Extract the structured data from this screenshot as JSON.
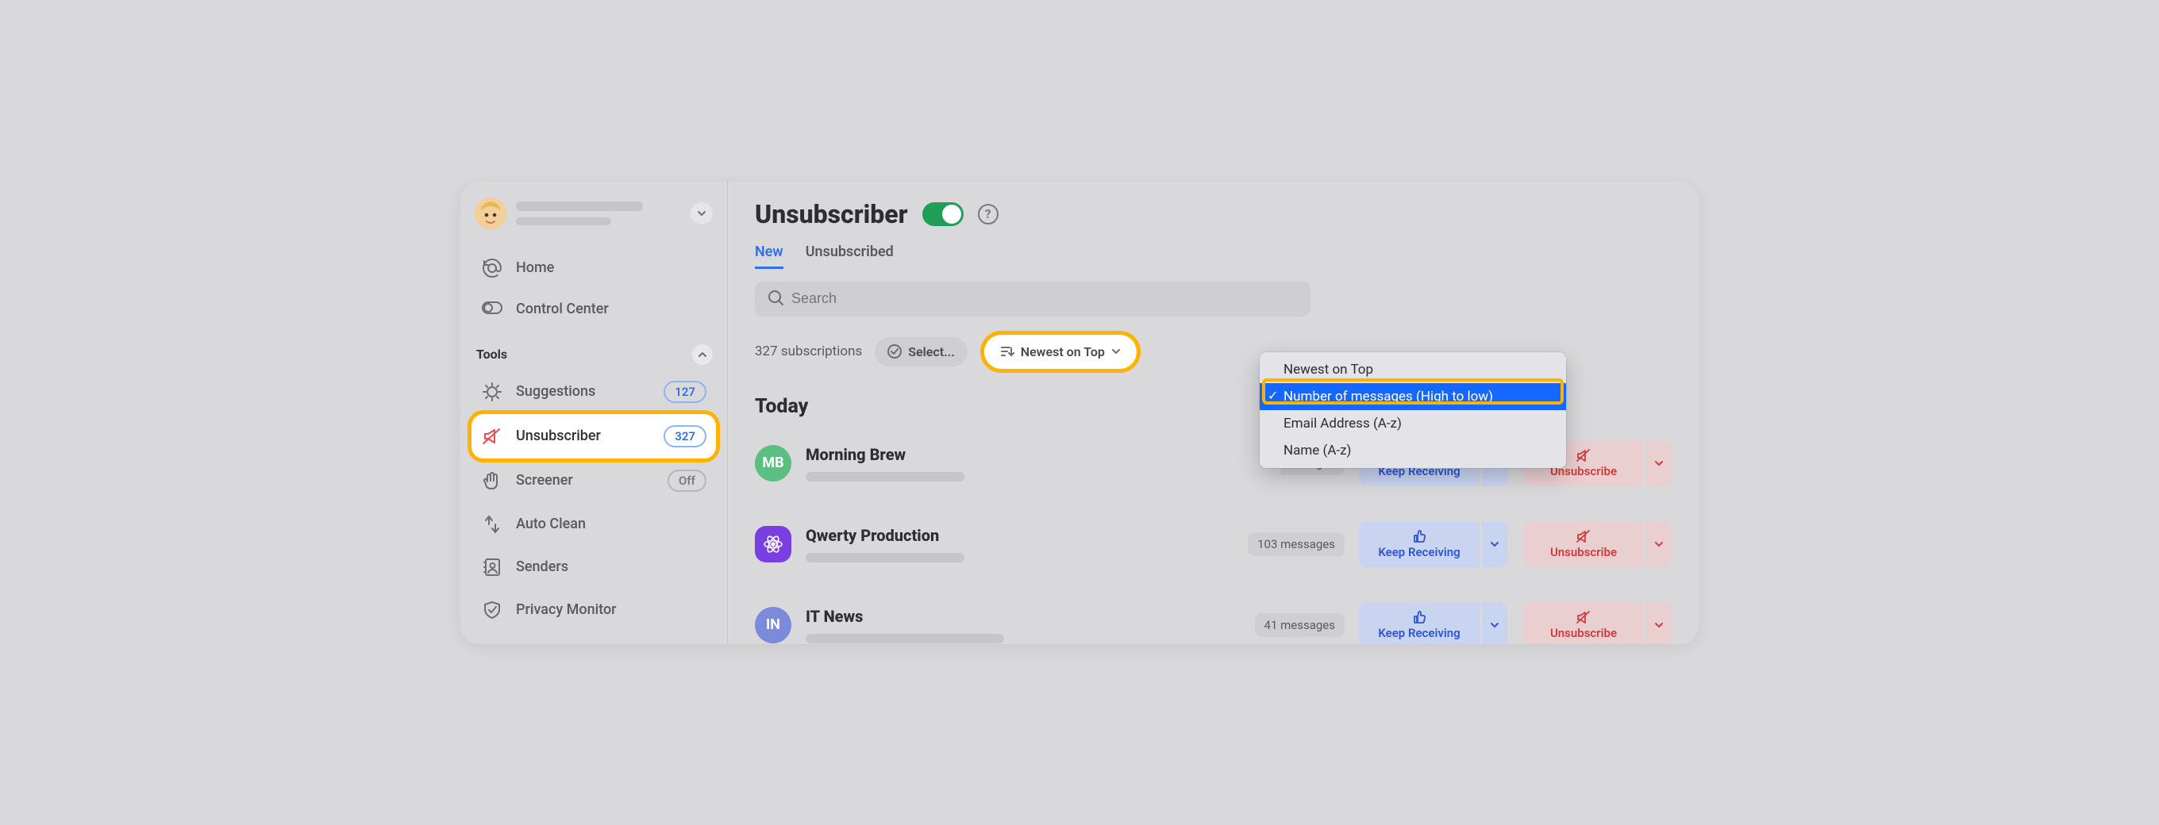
{
  "sidebar": {
    "nav": {
      "home": "Home",
      "control_center": "Control Center"
    },
    "tools_label": "Tools",
    "tools": {
      "suggestions": {
        "label": "Suggestions",
        "badge": "127"
      },
      "unsubscriber": {
        "label": "Unsubscriber",
        "badge": "327"
      },
      "screener": {
        "label": "Screener",
        "badge": "Off"
      },
      "auto_clean": {
        "label": "Auto Clean"
      },
      "senders": {
        "label": "Senders"
      },
      "privacy_monitor": {
        "label": "Privacy Monitor"
      }
    }
  },
  "header": {
    "title": "Unsubscriber",
    "help": "?",
    "tabs": {
      "new": "New",
      "unsubscribed": "Unsubscribed"
    }
  },
  "search": {
    "placeholder": "Search"
  },
  "toolbar": {
    "count_text": "327 subscriptions",
    "select_label": "Select...",
    "sort_label": "Newest on Top"
  },
  "sort_menu": {
    "items": [
      "Newest on Top",
      "Number of messages (High to low)",
      "Email Address (A-z)",
      "Name (A-z)"
    ],
    "selected_index": 1
  },
  "group": {
    "title": "Today"
  },
  "actions": {
    "keep": "Keep Receiving",
    "unsubscribe": "Unsubscribe"
  },
  "rows": [
    {
      "initials": "MB",
      "name": "Morning Brew",
      "color": "#5bbf82",
      "shape": "circle",
      "messages_suffix": "essages"
    },
    {
      "initials": "",
      "name": "Qwerty Production",
      "color": "#7a3fe0",
      "shape": "rounded",
      "messages": "103 messages"
    },
    {
      "initials": "IN",
      "name": "IT News",
      "color": "#7c8bd9",
      "shape": "circle",
      "messages": "41 messages"
    }
  ]
}
